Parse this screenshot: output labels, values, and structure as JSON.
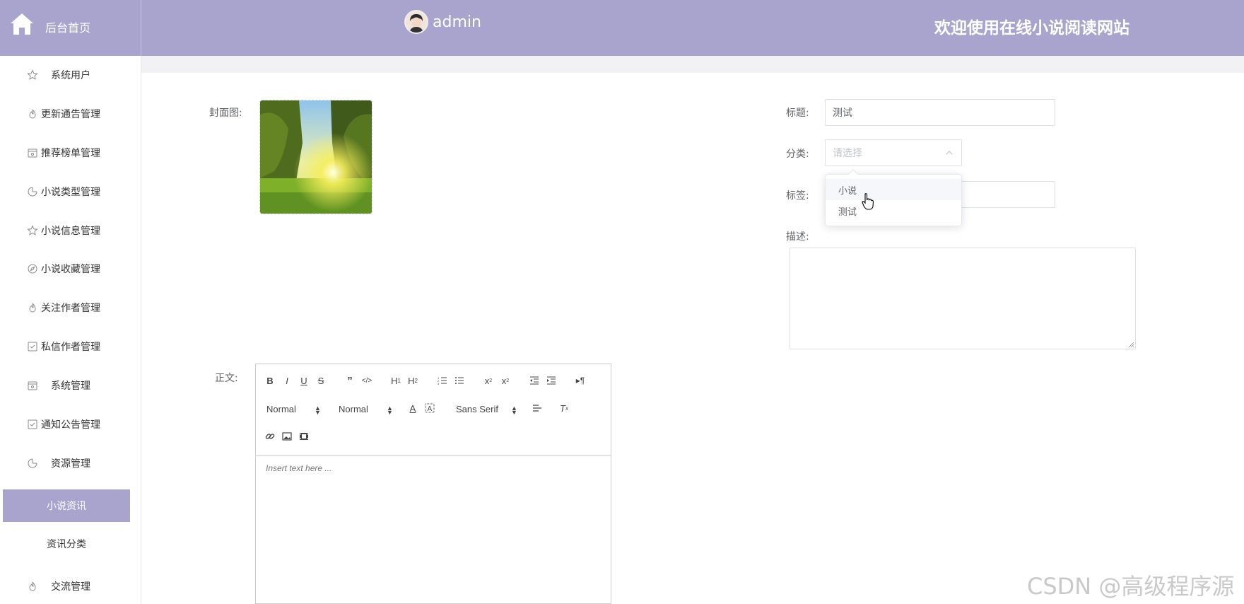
{
  "header": {
    "home_label": "后台首页",
    "username": "admin",
    "welcome": "欢迎使用在线小说阅读网站",
    "bg_color": "#a8a4cd"
  },
  "sidebar": {
    "items": [
      {
        "label": "系统用户",
        "icon": "star-icon"
      },
      {
        "label": "更新通告管理",
        "icon": "flame-icon"
      },
      {
        "label": "推荐榜单管理",
        "icon": "calendar-icon"
      },
      {
        "label": "小说类型管理",
        "icon": "pie-icon"
      },
      {
        "label": "小说信息管理",
        "icon": "star-icon"
      },
      {
        "label": "小说收藏管理",
        "icon": "compass-icon"
      },
      {
        "label": "关注作者管理",
        "icon": "flame-icon"
      },
      {
        "label": "私信作者管理",
        "icon": "checkbox-icon"
      },
      {
        "label": "系统管理",
        "icon": "calendar-icon"
      },
      {
        "label": "通知公告管理",
        "icon": "checkbox-icon"
      },
      {
        "label": "资源管理",
        "icon": "pie-icon"
      }
    ],
    "sub_items": [
      {
        "label": "小说资讯",
        "active": true
      },
      {
        "label": "资讯分类",
        "active": false
      }
    ],
    "last_item": {
      "label": "交流管理",
      "icon": "flame-icon"
    }
  },
  "form": {
    "cover_label": "封面图:",
    "title_label": "标题:",
    "title_value": "测试",
    "category_label": "分类:",
    "category_placeholder": "请选择",
    "tags_label": "标签:",
    "description_label": "描述:",
    "body_label": "正文:",
    "category_options": [
      "小说",
      "测试"
    ],
    "hovered_option": "小说"
  },
  "editor": {
    "header_picker": "Normal",
    "size_picker": "Normal",
    "font_picker": "Sans Serif",
    "placeholder": "Insert text here ..."
  },
  "watermark": "CSDN @高级程序源"
}
